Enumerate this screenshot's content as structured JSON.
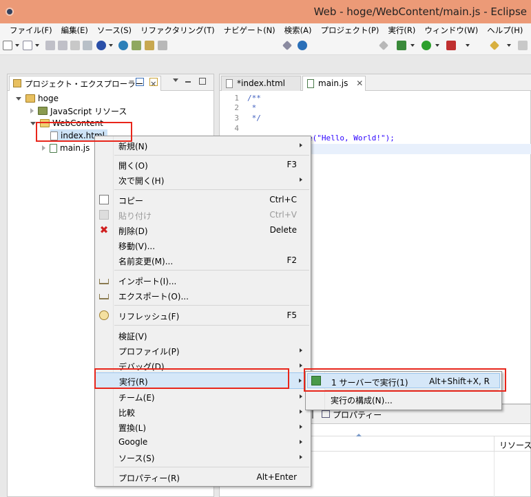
{
  "window": {
    "title": "Web - hoge/WebContent/main.js - Eclipse"
  },
  "menubar": [
    "ファイル(F)",
    "編集(E)",
    "ソース(S)",
    "リファクタリング(T)",
    "ナビゲート(N)",
    "検索(A)",
    "プロジェクト(P)",
    "実行(R)",
    "ウィンドウ(W)",
    "ヘルプ(H)"
  ],
  "explorer": {
    "tab_label": "プロジェクト・エクスプローラー",
    "tree": {
      "project": "hoge",
      "js_resources": "JavaScript リソース",
      "web_content": "WebContent",
      "index_file": "index.html",
      "main_file": "main.js"
    }
  },
  "editor": {
    "tabs": [
      "*index.html",
      "main.js"
    ],
    "lines": [
      {
        "n": "1",
        "text": "/**"
      },
      {
        "n": "2",
        "text": " *"
      },
      {
        "n": "3",
        "text": " */"
      },
      {
        "n": "4",
        "text": ""
      },
      {
        "n": "",
        "text": "e(\"Hello, World!\");"
      }
    ]
  },
  "context_menu": {
    "new": "新規(N)",
    "open": "開く(O)",
    "open_sc": "F3",
    "open_with": "次で開く(H)",
    "copy": "コピー",
    "copy_sc": "Ctrl+C",
    "paste": "貼り付け",
    "paste_sc": "Ctrl+V",
    "delete": "削除(D)",
    "delete_sc": "Delete",
    "move": "移動(V)...",
    "rename": "名前変更(M)...",
    "rename_sc": "F2",
    "import": "インポート(I)...",
    "export": "エクスポート(O)...",
    "refresh": "リフレッシュ(F)",
    "refresh_sc": "F5",
    "validate": "検証(V)",
    "profile": "プロファイル(P)",
    "debug": "デバッグ(D)",
    "run": "実行(R)",
    "team": "チーム(E)",
    "compare": "比較",
    "replace": "置換(L)",
    "google": "Google",
    "source": "ソース(S)",
    "properties": "プロパティー(R)",
    "properties_sc": "Alt+Enter"
  },
  "submenu": {
    "run_on_server": "1 サーバーで実行(1)",
    "run_on_server_sc": "Alt+Shift+X, R",
    "run_config": "実行の構成(N)..."
  },
  "bottom_panel": {
    "tab_label": "プロパティー",
    "col_resource": "リソース"
  }
}
